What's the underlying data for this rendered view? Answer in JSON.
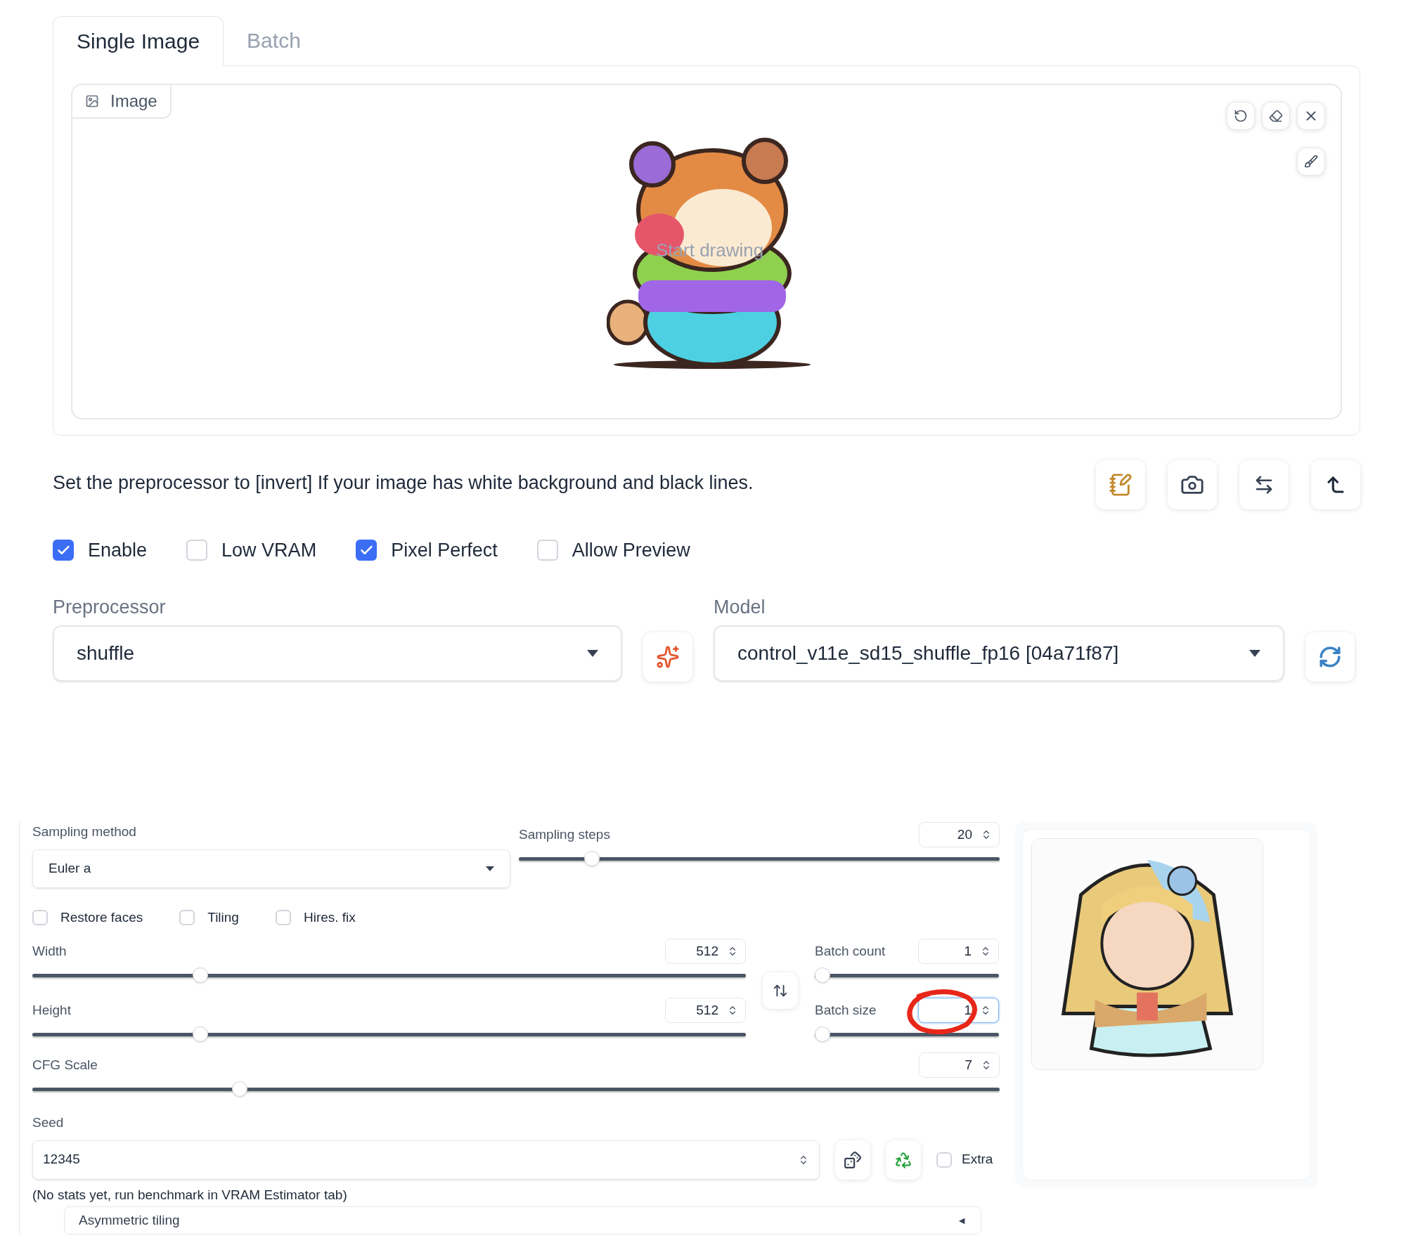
{
  "tabs": [
    {
      "label": "Single Image",
      "selected": true
    },
    {
      "label": "Batch",
      "selected": false
    }
  ],
  "image_panel": {
    "label": "Image",
    "placeholder": "Start drawing"
  },
  "hint": "Set the preprocessor to [invert] If your image has white background and black lines.",
  "options": [
    {
      "label": "Enable",
      "checked": true
    },
    {
      "label": "Low VRAM",
      "checked": false
    },
    {
      "label": "Pixel Perfect",
      "checked": true
    },
    {
      "label": "Allow Preview",
      "checked": false
    }
  ],
  "preprocessor": {
    "label": "Preprocessor",
    "value": "shuffle"
  },
  "model": {
    "label": "Model",
    "value": "control_v11e_sd15_shuffle_fp16 [04a71f87]"
  },
  "sampling_method": {
    "label": "Sampling method",
    "value": "Euler a"
  },
  "sampling_steps": {
    "label": "Sampling steps",
    "value": "20",
    "level": 0.14
  },
  "toggles": [
    {
      "label": "Restore faces",
      "checked": false
    },
    {
      "label": "Tiling",
      "checked": false
    },
    {
      "label": "Hires. fix",
      "checked": false
    }
  ],
  "size": [
    {
      "label": "Width",
      "value": "512",
      "level": 0.23
    },
    {
      "label": "Height",
      "value": "512",
      "level": 0.23
    }
  ],
  "batch": [
    {
      "label": "Batch count",
      "value": "1",
      "level": 0,
      "focused": false
    },
    {
      "label": "Batch size",
      "value": "1",
      "level": 0,
      "focused": true
    }
  ],
  "cfg_scale": {
    "label": "CFG Scale",
    "value": "7",
    "level": 0.21
  },
  "seed": {
    "label": "Seed",
    "value": "12345",
    "extra": {
      "label": "Extra",
      "checked": false
    }
  },
  "note": "(No stats yet, run benchmark in VRAM Estimator tab)",
  "accordion": {
    "label": "Asymmetric tiling",
    "arrow": "◄"
  }
}
